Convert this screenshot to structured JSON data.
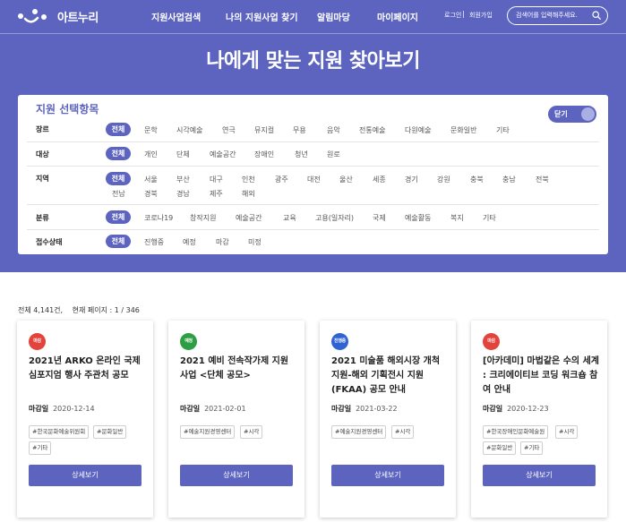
{
  "header": {
    "logo_text": "아트누리",
    "nav": [
      "지원사업검색",
      "나의 지원사업 찾기",
      "알림마당",
      "마이페이지"
    ],
    "login": "로그인",
    "signup": "회원가입",
    "search_placeholder": "검색어를 입력해주세요."
  },
  "page_title": "나에게 맞는 지원 찾아보기",
  "filter": {
    "title": "지원 선택항목",
    "toggle_label": "닫기",
    "all_label": "전체",
    "rows": [
      {
        "label": "장르",
        "options": [
          "문학",
          "시각예술",
          "연극",
          "뮤지컬",
          "무용",
          "음악",
          "전통예술",
          "다원예술",
          "문화일반",
          "기타"
        ]
      },
      {
        "label": "대상",
        "options": [
          "개인",
          "단체",
          "예술공간",
          "장애인",
          "청년",
          "원로"
        ]
      },
      {
        "label": "지역",
        "options": [
          "서울",
          "부산",
          "대구",
          "인천",
          "광주",
          "대전",
          "울산",
          "세종",
          "경기",
          "강원",
          "충북",
          "충남",
          "전북",
          "전남",
          "경북",
          "경남",
          "제주",
          "해외"
        ]
      },
      {
        "label": "분류",
        "options": [
          "코로나19",
          "창작지원",
          "예술공간",
          "교육",
          "고용(일자리)",
          "국제",
          "예술활동",
          "복지",
          "기타"
        ]
      },
      {
        "label": "접수상태",
        "options": [
          "진행중",
          "예정",
          "마감",
          "미정"
        ]
      }
    ]
  },
  "results": {
    "total": "전체 4,141건,",
    "page": "현재 페이지 : 1 / 346"
  },
  "cards": [
    {
      "status": "마감",
      "status_color": "#e2433a",
      "title": "2021년 ARKO 온라인 국제심포지엄 행사 주관처 공모",
      "deadline_label": "마감일",
      "deadline": "2020-12-14",
      "tags": [
        "#한국문화예술위원회",
        "#문화일반",
        "#기타"
      ],
      "button": "상세보기"
    },
    {
      "status": "예정",
      "status_color": "#2e9e44",
      "title": "2021 예비 전속작가제 지원 사업 <단체 공모>",
      "deadline_label": "마감일",
      "deadline": "2021-02-01",
      "tags": [
        "#예술지원경영센터",
        "#시각"
      ],
      "button": "상세보기"
    },
    {
      "status": "진행중",
      "status_color": "#2f62d3",
      "title": "2021 미술품 해외시장 개척 지원-해외 기획전시 지원(FKAA) 공모 안내",
      "deadline_label": "마감일",
      "deadline": "2021-03-22",
      "tags": [
        "#예술지원경영센터",
        "#시각"
      ],
      "button": "상세보기"
    },
    {
      "status": "마감",
      "status_color": "#e2433a",
      "title": "[아카데미] 마법같은 수의 세계 : 크리에이티브 코딩 워크숍 참여 안내",
      "deadline_label": "마감일",
      "deadline": "2020-12-23",
      "tags": [
        "#한국장애인문화예술원",
        "#시각",
        "#문화일반",
        "#기타"
      ],
      "button": "상세보기"
    }
  ]
}
